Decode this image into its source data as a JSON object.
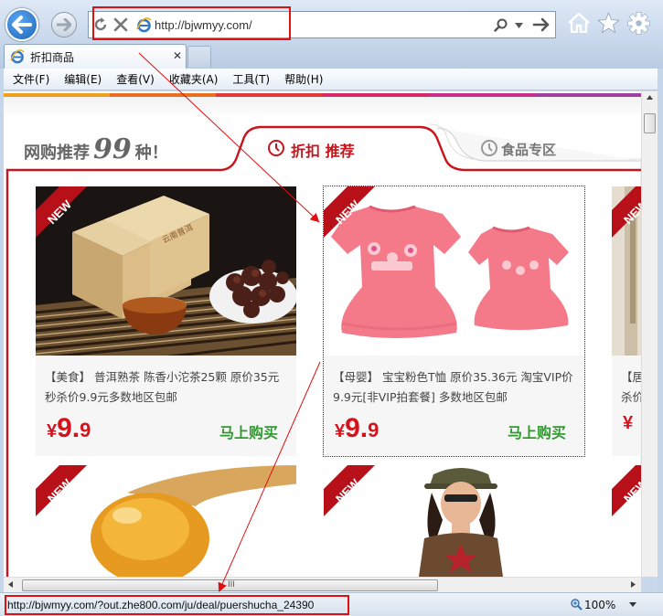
{
  "browser": {
    "address_url": "http://bjwmyy.com/",
    "tab_title": "折扣商品",
    "tab_close": "✕",
    "accent": "#e01010"
  },
  "menu": {
    "items": [
      "文件(F)",
      "编辑(E)",
      "查看(V)",
      "收藏夹(A)",
      "工具(T)",
      "帮助(H)"
    ]
  },
  "page": {
    "promo_prefix": "网购推荐",
    "promo_number": "99",
    "promo_suffix": "种！",
    "tab_discount": "折扣 推荐",
    "tab_food": "食品专区",
    "new_badge": "NEW",
    "color_strip": [
      "#f0a020",
      "#e87020",
      "#e03a3a",
      "#d82a6a",
      "#c8308a",
      "#a040a0"
    ],
    "brand_red": "#c8141c",
    "buy_green": "#2e9a2e",
    "products": [
      {
        "desc": "【美食】 普洱熟茶 陈香小沱茶25颗 原价35元 秒杀价9.9元多数地区包邮",
        "price_symbol": "¥",
        "price_int": "9.",
        "price_dec": "9",
        "buy_label": "马上购买"
      },
      {
        "desc": "【母婴】 宝宝粉色T恤 原价35.36元 淘宝VIP价9.9元[非VIP拍套餐] 多数地区包邮",
        "price_symbol": "¥",
        "price_int": "9.",
        "price_dec": "9",
        "buy_label": "马上购买"
      },
      {
        "desc": "【居 杀价",
        "price_symbol": "¥",
        "price_int": "",
        "price_dec": "",
        "buy_label": ""
      }
    ]
  },
  "scrollbar": {
    "grip": "III"
  },
  "status": {
    "url": "http://bjwmyy.com/?out.zhe800.com/ju/deal/puershucha_24390",
    "zoom": "100%"
  }
}
